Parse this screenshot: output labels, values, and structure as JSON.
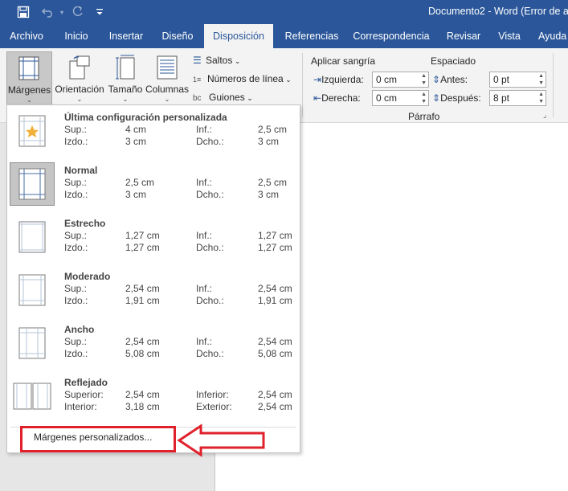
{
  "titlebar": {
    "document_title": "Documento2  -  Word (Error de a",
    "icons": [
      "save-icon",
      "undo-icon",
      "redo-icon",
      "customize-icon"
    ]
  },
  "tabs": [
    {
      "label": "Archivo",
      "active": false
    },
    {
      "label": "Inicio",
      "active": false
    },
    {
      "label": "Insertar",
      "active": false
    },
    {
      "label": "Diseño",
      "active": false
    },
    {
      "label": "Disposición",
      "active": true
    },
    {
      "label": "Referencias",
      "active": false
    },
    {
      "label": "Correspondencia",
      "active": false
    },
    {
      "label": "Revisar",
      "active": false
    },
    {
      "label": "Vista",
      "active": false
    },
    {
      "label": "Ayuda",
      "active": false
    }
  ],
  "ribbon": {
    "margins": "Márgenes",
    "orientation": "Orientación",
    "size": "Tamaño",
    "columns": "Columnas",
    "breaks": "Saltos",
    "line_numbers": "Números de línea",
    "hyphenation": "Guiones",
    "indent_header": "Aplicar sangría",
    "indent_left_label": "Izquierda:",
    "indent_left_value": "0 cm",
    "indent_right_label": "Derecha:",
    "indent_right_value": "0 cm",
    "spacing_header": "Espaciado",
    "spacing_before_label": "Antes:",
    "spacing_before_value": "0 pt",
    "spacing_after_label": "Después:",
    "spacing_after_value": "8 pt",
    "paragraph_group": "Párrafo"
  },
  "margins_menu": {
    "options": [
      {
        "title": "Última configuración personalizada",
        "l1": "Sup.:",
        "v1": "4 cm",
        "l2": "Inf.:",
        "v2": "2,5 cm",
        "l3": "Izdo.:",
        "v3": "3 cm",
        "l4": "Dcho.:",
        "v4": "3 cm",
        "icon": "custom-star-margins-icon"
      },
      {
        "title": "Normal",
        "l1": "Sup.:",
        "v1": "2,5 cm",
        "l2": "Inf.:",
        "v2": "2,5 cm",
        "l3": "Izdo.:",
        "v3": "3 cm",
        "l4": "Dcho.:",
        "v4": "3 cm",
        "icon": "normal-margins-icon",
        "selected": true
      },
      {
        "title": "Estrecho",
        "l1": "Sup.:",
        "v1": "1,27 cm",
        "l2": "Inf.:",
        "v2": "1,27 cm",
        "l3": "Izdo.:",
        "v3": "1,27 cm",
        "l4": "Dcho.:",
        "v4": "1,27 cm",
        "icon": "narrow-margins-icon"
      },
      {
        "title": "Moderado",
        "l1": "Sup.:",
        "v1": "2,54 cm",
        "l2": "Inf.:",
        "v2": "2,54 cm",
        "l3": "Izdo.:",
        "v3": "1,91 cm",
        "l4": "Dcho.:",
        "v4": "1,91 cm",
        "icon": "moderate-margins-icon"
      },
      {
        "title": "Ancho",
        "l1": "Sup.:",
        "v1": "2,54 cm",
        "l2": "Inf.:",
        "v2": "2,54 cm",
        "l3": "Izdo.:",
        "v3": "5,08 cm",
        "l4": "Dcho.:",
        "v4": "5,08 cm",
        "icon": "wide-margins-icon"
      },
      {
        "title": "Reflejado",
        "l1": "Superior:",
        "v1": "2,54 cm",
        "l2": "Inferior:",
        "v2": "2,54 cm",
        "l3": "Interior:",
        "v3": "3,18 cm",
        "l4": "Exterior:",
        "v4": "2,54 cm",
        "icon": "mirrored-margins-icon"
      }
    ],
    "custom_label": "Márgenes personalizados..."
  },
  "colors": {
    "word_blue": "#2b579a",
    "annotation_red": "#e0202a",
    "ribbon_bg": "#f3f3f3"
  }
}
